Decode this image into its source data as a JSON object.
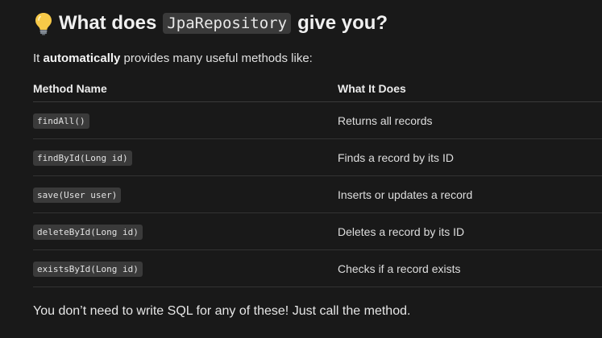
{
  "heading": {
    "prefix": "What does",
    "code": "JpaRepository",
    "suffix": "give you?"
  },
  "intro": {
    "before": "It ",
    "bold": "automatically",
    "after": " provides many useful methods like:"
  },
  "table": {
    "headers": [
      "Method Name",
      "What It Does"
    ],
    "rows": [
      {
        "method": "findAll()",
        "desc": "Returns all records"
      },
      {
        "method": "findById(Long id)",
        "desc": "Finds a record by its ID"
      },
      {
        "method": "save(User user)",
        "desc": "Inserts or updates a record"
      },
      {
        "method": "deleteById(Long id)",
        "desc": "Deletes a record by its ID"
      },
      {
        "method": "existsById(Long id)",
        "desc": "Checks if a record exists"
      }
    ]
  },
  "footer": "You don’t need to write SQL for any of these! Just call the method.",
  "colors": {
    "background": "#191919",
    "code_bg": "#3a3a3a",
    "bulb": "#f7c948"
  }
}
